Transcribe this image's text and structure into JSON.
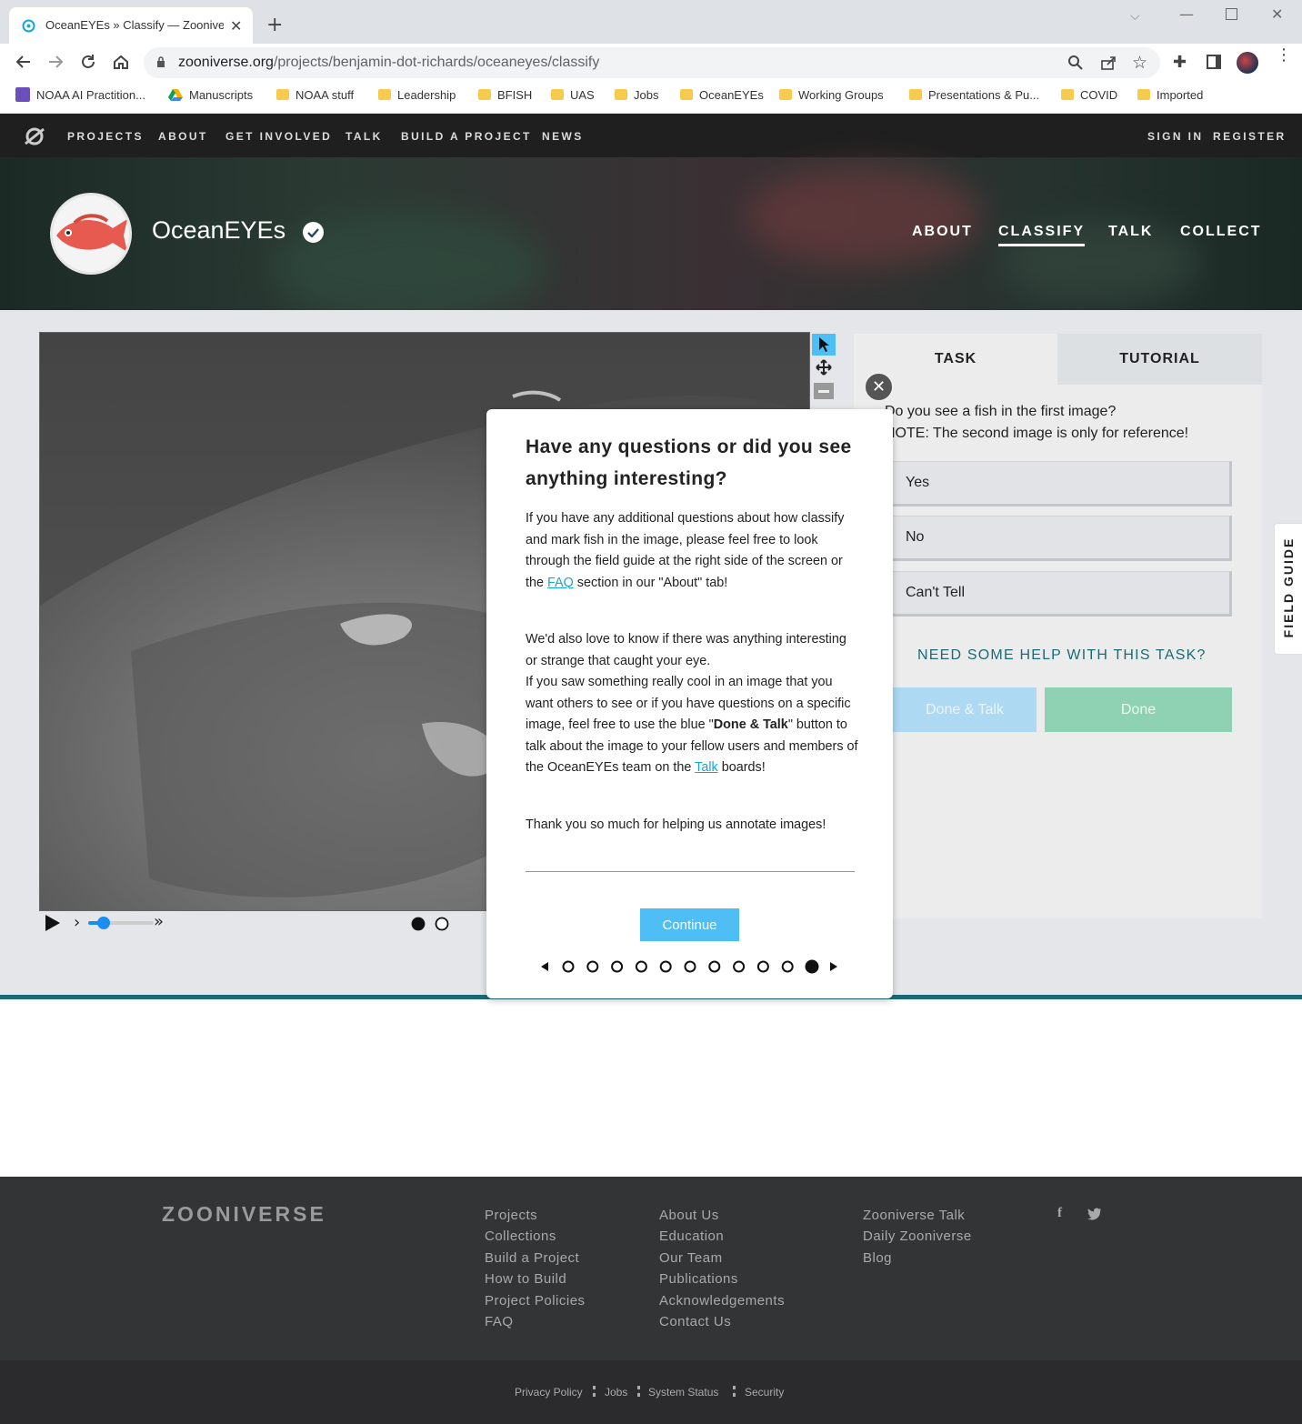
{
  "browser": {
    "tab_title": "OceanEYEs » Classify — Zooniverse",
    "url_host": "zooniverse.org",
    "url_path": "/projects/benjamin-dot-richards/oceaneyes/classify",
    "bookmarks": [
      "NOAA AI Practition...",
      "Manuscripts",
      "NOAA stuff",
      "Leadership",
      "BFISH",
      "UAS",
      "Jobs",
      "OceanEYEs",
      "Working Groups",
      "Presentations & Pu...",
      "COVID",
      "Imported"
    ]
  },
  "sitenav": {
    "links": [
      "PROJECTS",
      "ABOUT",
      "GET INVOLVED",
      "TALK",
      "BUILD A PROJECT",
      "NEWS"
    ],
    "sign_in": "SIGN IN",
    "register": "REGISTER"
  },
  "project": {
    "name": "OceanEYEs",
    "nav": [
      "ABOUT",
      "CLASSIFY",
      "TALK",
      "COLLECT"
    ],
    "active_nav": "CLASSIFY"
  },
  "task": {
    "tab_task": "TASK",
    "tab_tutorial": "TUTORIAL",
    "question_line1": "Do you see a fish in the first image?",
    "question_line2": "NOTE: The second image is only for reference!",
    "answers": [
      "Yes",
      "No",
      "Can't Tell"
    ],
    "help": "NEED SOME HELP WITH THIS TASK?",
    "done_talk": "Done & Talk",
    "done": "Done",
    "field_guide": "FIELD GUIDE"
  },
  "modal": {
    "heading": "Have any questions or did you see anything interesting?",
    "p1_pre": "If you have any additional questions about how classify and mark fish in the image, please feel free to look through the field guide at the right side of the screen or the ",
    "p1_link": "FAQ",
    "p1_post": " section in our \"About\" tab!",
    "p2a": "We'd also love to know if there was anything interesting or strange that caught your eye.",
    "p2b_pre": "If you saw something really cool in an image that you want others to see or if you have questions on a specific image, feel free to use the blue \"",
    "p2b_bold": "Done & Talk",
    "p2b_mid": "\" button to talk about the image to your fellow users and members of the OceanEYEs team on the ",
    "p2b_link": "Talk",
    "p2b_post": " boards!",
    "p3": "Thank you so much for helping us annotate images!",
    "continue": "Continue",
    "step_count": 11,
    "active_step": 10
  },
  "viewer": {
    "frame_count": 2,
    "active_frame": 1
  },
  "footer": {
    "logo": "ZOONIVERSE",
    "col1": [
      "Projects",
      "Collections",
      "Build a Project",
      "How to Build",
      "Project Policies",
      "FAQ"
    ],
    "col2": [
      "About Us",
      "Education",
      "Our Team",
      "Publications",
      "Acknowledgements",
      "Contact Us"
    ],
    "col3": [
      "Zooniverse Talk",
      "Daily Zooniverse",
      "Blog"
    ],
    "bottom": [
      "Privacy Policy",
      "Jobs",
      "System Status",
      "Security"
    ]
  },
  "colors": {
    "accent_teal": "#1b6a77",
    "continue_blue": "#4ebef5",
    "done_green": "#8ed2b3",
    "done_talk_blue": "#aed9f2"
  }
}
